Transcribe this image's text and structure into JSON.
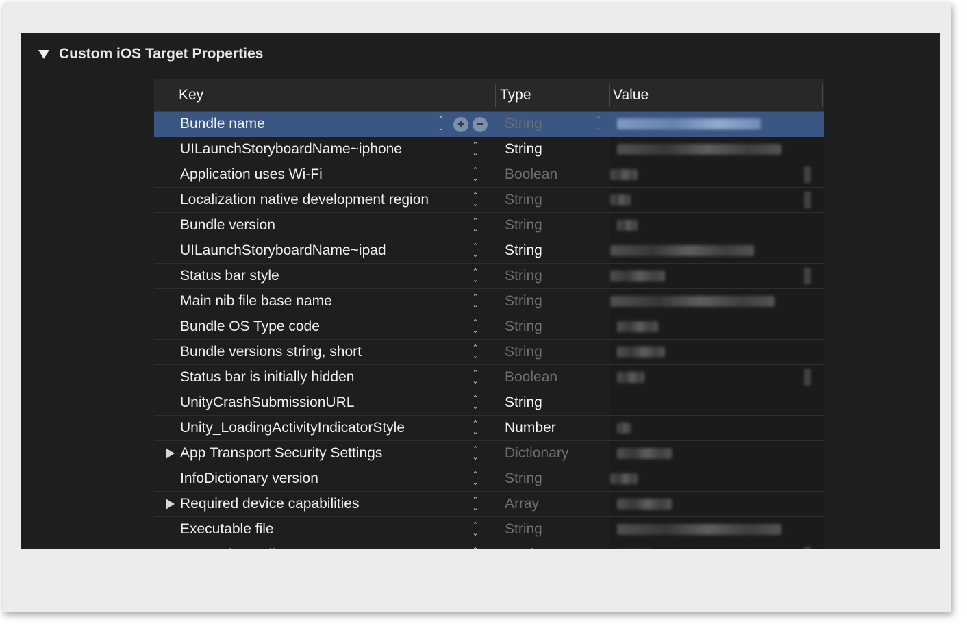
{
  "section": {
    "title": "Custom iOS Target Properties"
  },
  "table": {
    "headers": {
      "key": "Key",
      "type": "Type",
      "value": "Value"
    },
    "rows": [
      {
        "key": "Bundle name",
        "type": "String",
        "selected": true,
        "expandable": false,
        "type_bright": false
      },
      {
        "key": "UILaunchStoryboardName~iphone",
        "type": "String",
        "selected": false,
        "expandable": false,
        "type_bright": true
      },
      {
        "key": "Application uses Wi-Fi",
        "type": "Boolean",
        "selected": false,
        "expandable": false,
        "type_bright": false
      },
      {
        "key": "Localization native development region",
        "type": "String",
        "selected": false,
        "expandable": false,
        "type_bright": false
      },
      {
        "key": "Bundle version",
        "type": "String",
        "selected": false,
        "expandable": false,
        "type_bright": false
      },
      {
        "key": "UILaunchStoryboardName~ipad",
        "type": "String",
        "selected": false,
        "expandable": false,
        "type_bright": true
      },
      {
        "key": "Status bar style",
        "type": "String",
        "selected": false,
        "expandable": false,
        "type_bright": false
      },
      {
        "key": "Main nib file base name",
        "type": "String",
        "selected": false,
        "expandable": false,
        "type_bright": false
      },
      {
        "key": "Bundle OS Type code",
        "type": "String",
        "selected": false,
        "expandable": false,
        "type_bright": false
      },
      {
        "key": "Bundle versions string, short",
        "type": "String",
        "selected": false,
        "expandable": false,
        "type_bright": false
      },
      {
        "key": "Status bar is initially hidden",
        "type": "Boolean",
        "selected": false,
        "expandable": false,
        "type_bright": false
      },
      {
        "key": "UnityCrashSubmissionURL",
        "type": "String",
        "selected": false,
        "expandable": false,
        "type_bright": true
      },
      {
        "key": "Unity_LoadingActivityIndicatorStyle",
        "type": "Number",
        "selected": false,
        "expandable": false,
        "type_bright": true
      },
      {
        "key": "App Transport Security Settings",
        "type": "Dictionary",
        "selected": false,
        "expandable": true,
        "type_bright": false
      },
      {
        "key": "InfoDictionary version",
        "type": "String",
        "selected": false,
        "expandable": false,
        "type_bright": false
      },
      {
        "key": "Required device capabilities",
        "type": "Array",
        "selected": false,
        "expandable": true,
        "type_bright": false
      },
      {
        "key": "Executable file",
        "type": "String",
        "selected": false,
        "expandable": false,
        "type_bright": false
      },
      {
        "key": "UIRequiresFullScreen",
        "type": "Boolean",
        "selected": false,
        "expandable": false,
        "type_bright": true
      }
    ]
  },
  "icons": {
    "disclosure": "triangle-down-icon",
    "expander": "triangle-right-icon",
    "stepper": "up-down-chevron-icon",
    "add": "plus-circle-icon",
    "remove": "minus-circle-icon"
  },
  "colors": {
    "panel_bg": "#1e1e1e",
    "selection": "#3a5683",
    "dim_type": "#6f6f6f"
  }
}
